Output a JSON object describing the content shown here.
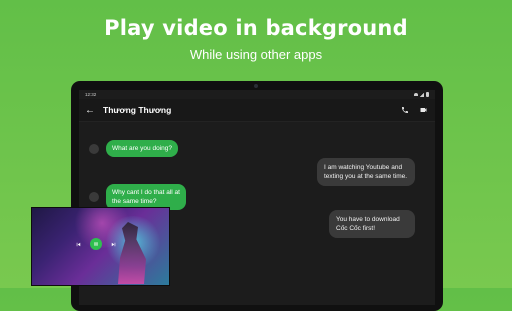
{
  "promo": {
    "headline": "Play video in background",
    "subheadline": "While using other apps"
  },
  "device": {
    "status_time": "12:32",
    "contact_name": "Thương Thương"
  },
  "messages": [
    {
      "side": "incoming",
      "text": "What are you doing?"
    },
    {
      "side": "outgoing",
      "text": "I am watching Youtube and texting you at the same time."
    },
    {
      "side": "incoming",
      "text": "Why cant I do that all at the same time?"
    },
    {
      "side": "outgoing",
      "text": "You have to download Cốc Cốc first!"
    }
  ],
  "pip_player": {
    "icons": [
      "previous-icon",
      "pause-icon",
      "next-icon"
    ]
  },
  "colors": {
    "background": "#6cc44c",
    "incoming_bubble": "#2fae4a",
    "outgoing_bubble": "#3a3a3a",
    "screen": "#1c1c1c"
  }
}
